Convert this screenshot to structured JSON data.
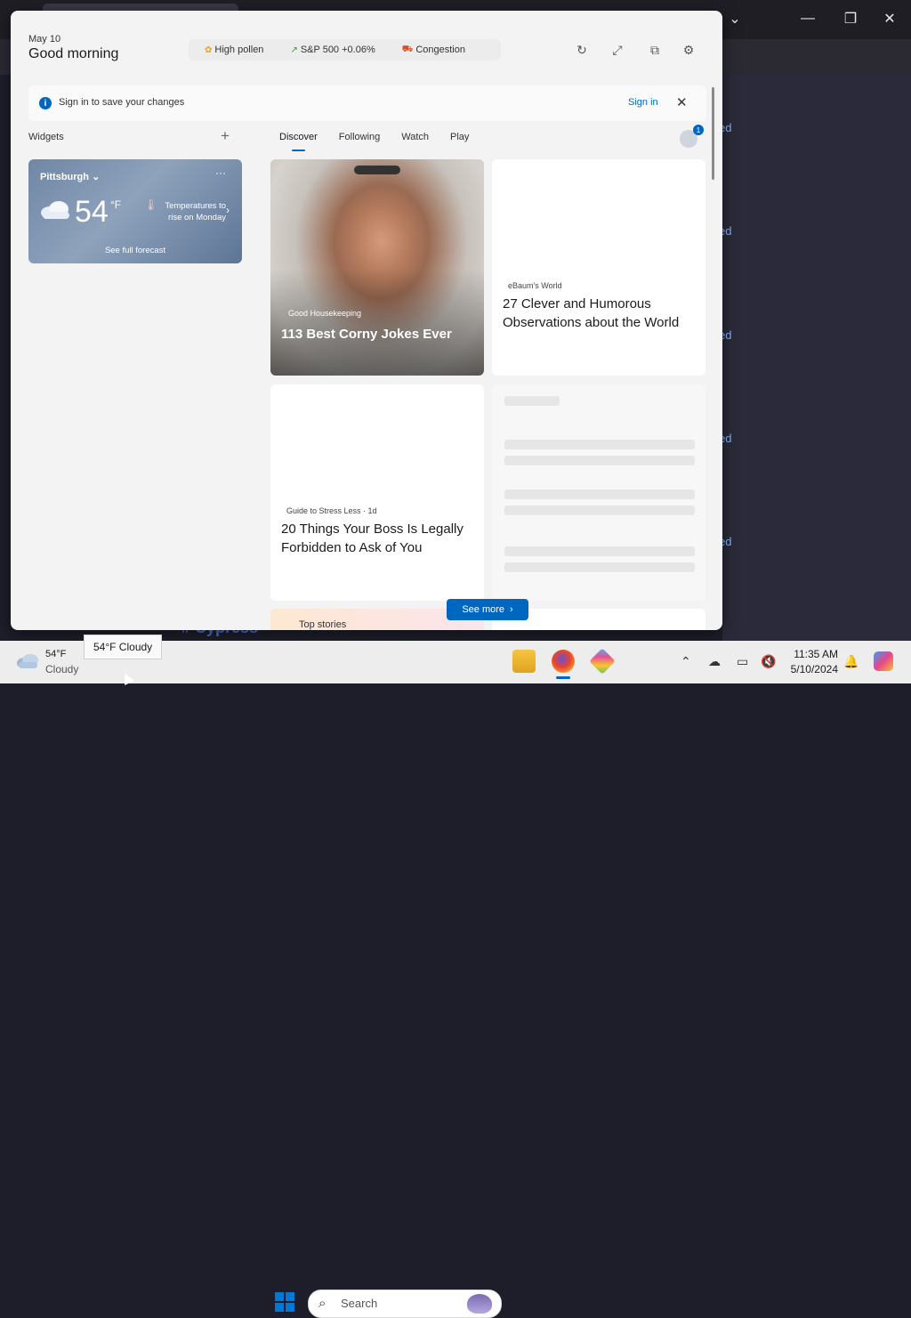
{
  "background_links": [
    "ed",
    "ed",
    "ed",
    "ed",
    "ed"
  ],
  "background_text": "# Cypress",
  "panel": {
    "date": "May 10",
    "greeting": "Good morning",
    "chips": [
      {
        "icon": "pollen-icon",
        "label": "High pollen"
      },
      {
        "icon": "stock-up-icon",
        "label": "S&P 500 +0.06%"
      },
      {
        "icon": "traffic-icon",
        "label": "Congestion"
      }
    ],
    "signin_bar": {
      "text": "Sign in to save your changes",
      "link": "Sign in"
    },
    "widgets_label": "Widgets",
    "weather": {
      "city": "Pittsburgh",
      "temp": "54",
      "unit": "°F",
      "description": "Temperatures to rise on Monday",
      "forecast_link": "See full forecast"
    },
    "tabs": [
      "Discover",
      "Following",
      "Watch",
      "Play"
    ],
    "active_tab": "Discover",
    "notification_count": "1",
    "cards": [
      {
        "source": "Good Housekeeping",
        "title": "113 Best Corny Jokes Ever"
      },
      {
        "source": "eBaum's World",
        "title": "27 Clever and Humorous Observations about the World"
      },
      {
        "source": "Guide to Stress Less · 1d",
        "title": "20 Things Your Boss Is Legally Forbidden to Ask of You"
      }
    ],
    "see_more": "See more",
    "top_stories": "Top stories"
  },
  "taskbar": {
    "weather_temp": "54°F",
    "weather_cond": "Cloudy",
    "tooltip": "54°F Cloudy",
    "search_placeholder": "Search",
    "time": "11:35 AM",
    "date": "5/10/2024"
  }
}
